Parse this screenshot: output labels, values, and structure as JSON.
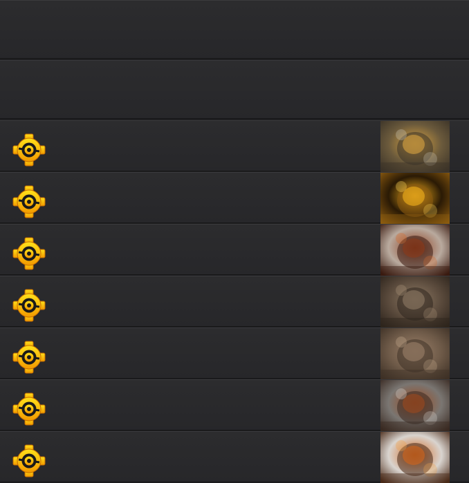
{
  "list": {
    "empty_rows": 2,
    "items": [
      {
        "badge_icon": "gear-badge-icon",
        "thumbnail": "armored-warrior-explosion-thumbnail",
        "palette": [
          "#6b5a3c",
          "#d9a441",
          "#3b3328",
          "#c9c2b3"
        ]
      },
      {
        "badge_icon": "gear-badge-icon",
        "thumbnail": "golden-mechanical-orb-thumbnail",
        "palette": [
          "#2a1a05",
          "#f2b01c",
          "#8a5a10",
          "#ffd75a"
        ]
      },
      {
        "badge_icon": "gear-badge-icon",
        "thumbnail": "round-bomb-creature-thumbnail",
        "palette": [
          "#b9aa9e",
          "#8c3b1b",
          "#3a1a10",
          "#d76b2a"
        ]
      },
      {
        "badge_icon": "gear-badge-icon",
        "thumbnail": "stone-golem-thumbnail",
        "palette": [
          "#5a4a3c",
          "#8e7a64",
          "#2e251d",
          "#a89278"
        ]
      },
      {
        "badge_icon": "gear-badge-icon",
        "thumbnail": "boulder-pile-thumbnail",
        "palette": [
          "#6e5a48",
          "#9b8069",
          "#3e3126",
          "#c2a98c"
        ]
      },
      {
        "badge_icon": "gear-badge-icon",
        "thumbnail": "brute-warrior-smoke-thumbnail",
        "palette": [
          "#7a7672",
          "#9b4a20",
          "#3a2a22",
          "#d8d2cb"
        ]
      },
      {
        "badge_icon": "gear-badge-icon",
        "thumbnail": "lightning-brawler-thumbnail",
        "palette": [
          "#d9d4cf",
          "#d1661e",
          "#4a2a18",
          "#f3a34a"
        ]
      }
    ]
  },
  "colors": {
    "badge_top": "#ffe01a",
    "badge_bottom": "#f29a00",
    "badge_ring": "#1a1a1a"
  }
}
